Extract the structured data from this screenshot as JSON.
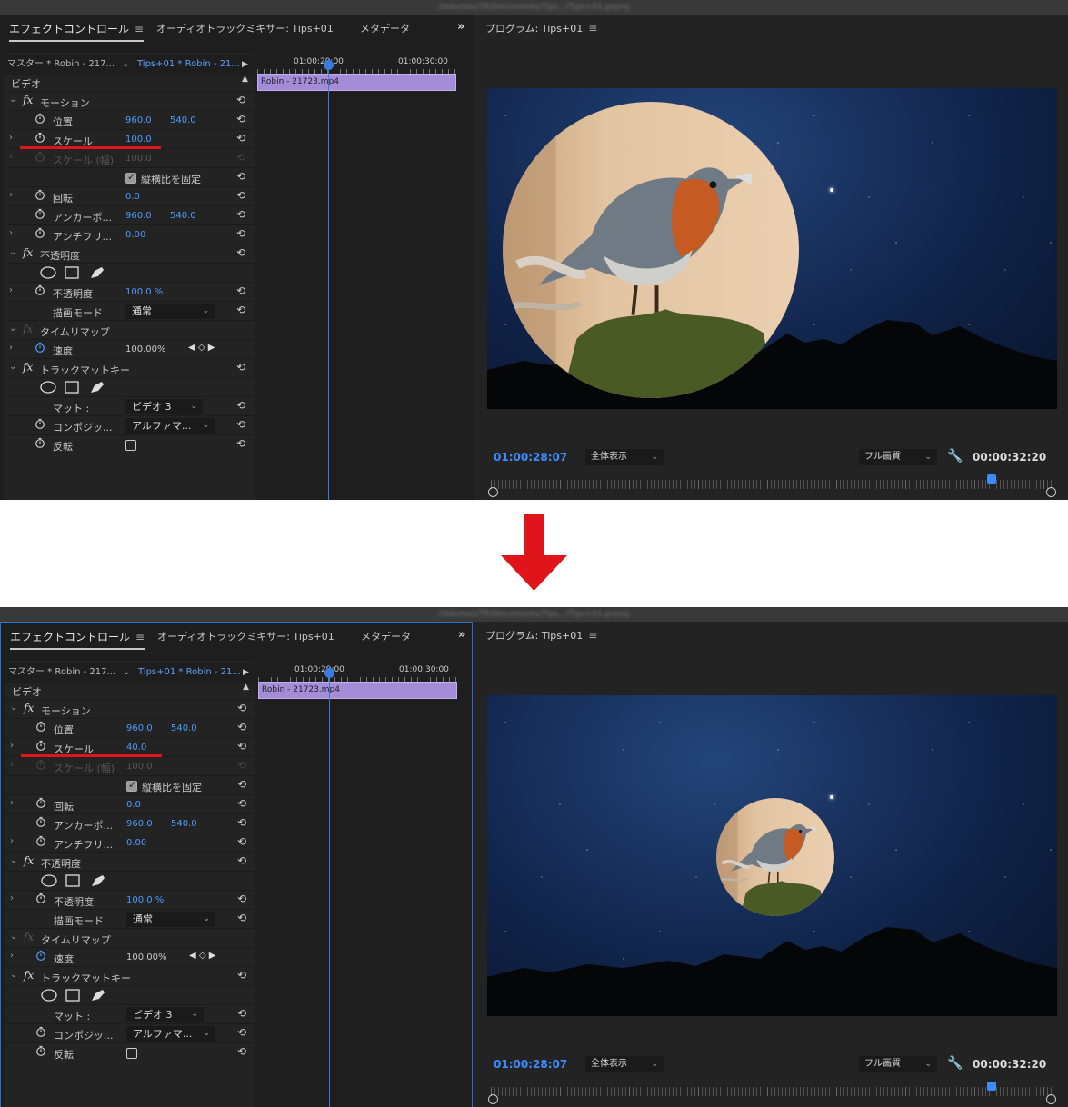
{
  "screens": [
    {
      "path": "/Volumes/TR/Documents/Tips.../Tips+01.prproj",
      "tabs": {
        "effect_controls": "エフェクトコントロール",
        "audio_mixer": "オーディオトラックミキサー: Tips+01",
        "metadata": "メタデータ",
        "more": "»"
      },
      "master_label": "マスター * Robin - 217...",
      "sequence_label": "Tips+01 * Robin - 21...",
      "section_video": "ビデオ",
      "timeline": {
        "time1": "01:00:29:00",
        "time2": "01:00:30:00",
        "clip": "Robin - 21723.mp4"
      },
      "motion": {
        "title": "モーション",
        "position_label": "位置",
        "position_x": "960.0",
        "position_y": "540.0",
        "scale_label": "スケール",
        "scale_value": "100.0",
        "scale_width_label": "スケール (幅)",
        "scale_width_value": "100.0",
        "uniform_label": "縦横比を固定",
        "rotation_label": "回転",
        "rotation_value": "0.0",
        "anchor_label": "アンカーポ...",
        "anchor_x": "960.0",
        "anchor_y": "540.0",
        "antiflicker_label": "アンチフリ...",
        "antiflicker_value": "0.00"
      },
      "opacity": {
        "title": "不透明度",
        "opacity_label": "不透明度",
        "opacity_value": "100.0 %",
        "blend_label": "描画モード",
        "blend_value": "通常"
      },
      "time_remap": {
        "title": "タイムリマップ",
        "speed_label": "速度",
        "speed_value": "100.00%"
      },
      "track_matte": {
        "title": "トラックマットキー",
        "matte_label": "マット :",
        "matte_value": "ビデオ 3",
        "composite_label": "コンポジッ...",
        "composite_value": "アルファマ...",
        "reverse_label": "反転"
      },
      "program": {
        "title": "プログラム: Tips+01",
        "timecode_left": "01:00:28:07",
        "fit": "全体表示",
        "quality": "フル画質",
        "timecode_right": "00:00:32:20"
      },
      "circle_scale_percent": 100
    },
    {
      "path": "/Volumes/TR/Documents/Tips.../Tips+01.prproj",
      "tabs": {
        "effect_controls": "エフェクトコントロール",
        "audio_mixer": "オーディオトラックミキサー: Tips+01",
        "metadata": "メタデータ",
        "more": "»"
      },
      "master_label": "マスター * Robin - 217...",
      "sequence_label": "Tips+01 * Robin - 21...",
      "section_video": "ビデオ",
      "timeline": {
        "time1": "01:00:29:00",
        "time2": "01:00:30:00",
        "clip": "Robin - 21723.mp4"
      },
      "motion": {
        "title": "モーション",
        "position_label": "位置",
        "position_x": "960.0",
        "position_y": "540.0",
        "scale_label": "スケール",
        "scale_value": "40.0",
        "scale_width_label": "スケール (幅)",
        "scale_width_value": "100.0",
        "uniform_label": "縦横比を固定",
        "rotation_label": "回転",
        "rotation_value": "0.0",
        "anchor_label": "アンカーポ...",
        "anchor_x": "960.0",
        "anchor_y": "540.0",
        "antiflicker_label": "アンチフリ...",
        "antiflicker_value": "0.00"
      },
      "opacity": {
        "title": "不透明度",
        "opacity_label": "不透明度",
        "opacity_value": "100.0 %",
        "blend_label": "描画モード",
        "blend_value": "通常"
      },
      "time_remap": {
        "title": "タイムリマップ",
        "speed_label": "速度",
        "speed_value": "100.00%"
      },
      "track_matte": {
        "title": "トラックマットキー",
        "matte_label": "マット :",
        "matte_value": "ビデオ 3",
        "composite_label": "コンポジッ...",
        "composite_value": "アルファマ...",
        "reverse_label": "反転"
      },
      "program": {
        "title": "プログラム: Tips+01",
        "timecode_left": "01:00:28:07",
        "fit": "全体表示",
        "quality": "フル画質",
        "timecode_right": "00:00:32:20"
      },
      "circle_scale_percent": 40
    }
  ],
  "colors": {
    "highlight_underline": "#e0141b",
    "arrow": "#e0141b",
    "value_blue": "#4e9bff",
    "clip_purple": "#a48cd8",
    "playhead": "#3b7be0"
  },
  "icons": [
    "hamburger-icon",
    "stopwatch-icon",
    "reset-icon",
    "ellipse-mask-icon",
    "rectangle-mask-icon",
    "pen-mask-icon",
    "wrench-icon",
    "down-arrow-icon"
  ]
}
